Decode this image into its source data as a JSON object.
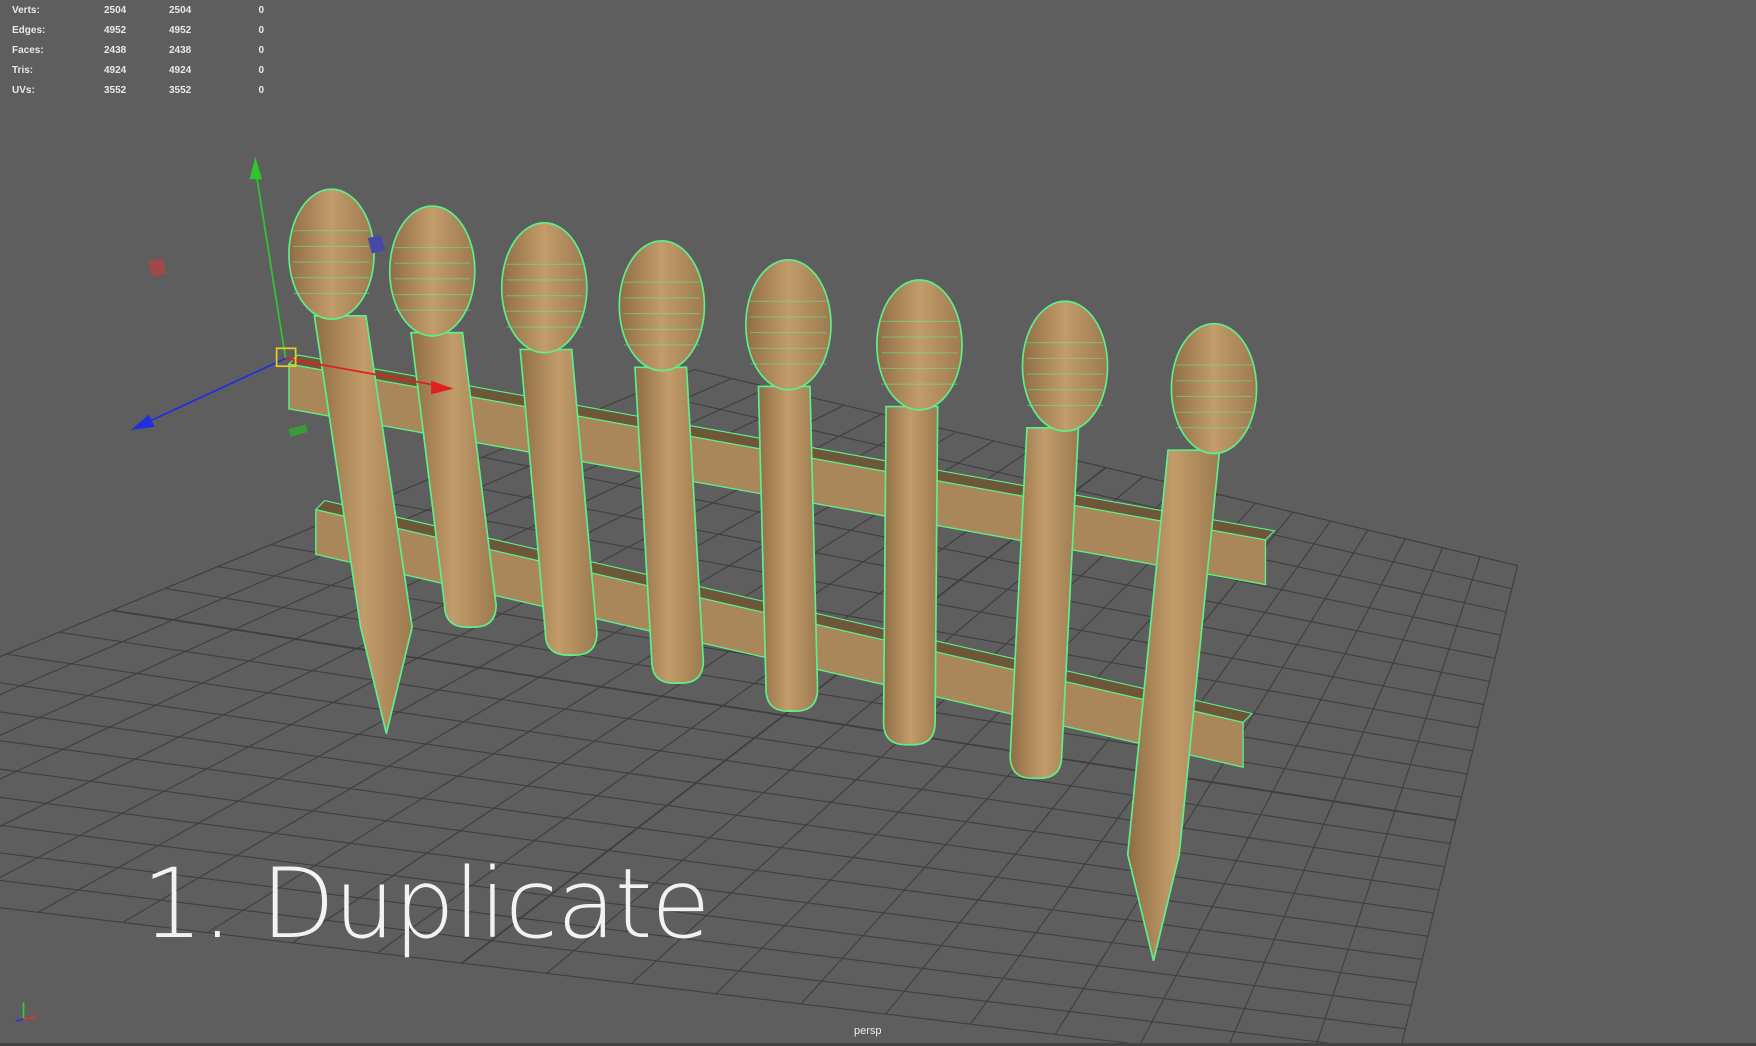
{
  "heads_up_display": {
    "rows": [
      {
        "label": "Verts:",
        "values": [
          "2504",
          "2504",
          "0"
        ]
      },
      {
        "label": "Edges:",
        "values": [
          "4952",
          "4952",
          "0"
        ]
      },
      {
        "label": "Faces:",
        "values": [
          "2438",
          "2438",
          "0"
        ]
      },
      {
        "label": "Tris:",
        "values": [
          "4924",
          "4924",
          "0"
        ]
      },
      {
        "label": "UVs:",
        "values": [
          "3552",
          "3552",
          "0"
        ]
      }
    ]
  },
  "overlay_title": "1. Duplicate",
  "camera_label": "persp",
  "axis_labels": {
    "y": "y",
    "z": "z",
    "x": "x"
  },
  "colors": {
    "background": "#5e5e5e",
    "grid": "#3f3f3f",
    "wood": "#b08a5a",
    "wireframe": "#5cf08c"
  }
}
